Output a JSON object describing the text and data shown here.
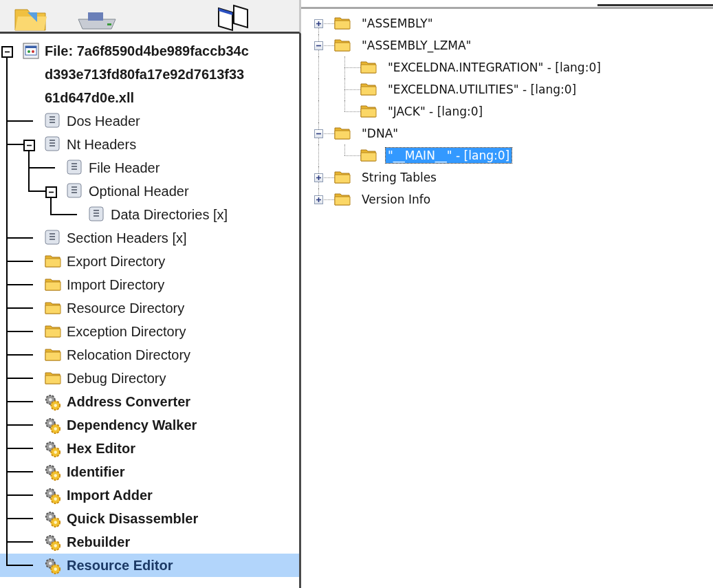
{
  "left_tree": {
    "root": {
      "title_lines": [
        "File: 7a6f8590d4be989faccb34c",
        "d393e713fd80fa17e92d7613f33",
        "61d647d0e.xll"
      ],
      "expanded": true,
      "selected": false,
      "children": [
        {
          "kind": "header",
          "label": "Dos Header",
          "selected": false
        },
        {
          "kind": "header",
          "label": "Nt Headers",
          "selected": false,
          "expanded": true,
          "children": [
            {
              "kind": "header",
              "label": "File Header",
              "selected": false
            },
            {
              "kind": "header",
              "label": "Optional Header",
              "selected": false,
              "expanded": true,
              "children": [
                {
                  "kind": "header",
                  "label": "Data Directories [x]",
                  "selected": false
                }
              ]
            }
          ]
        },
        {
          "kind": "header",
          "label": "Section Headers [x]",
          "selected": false
        },
        {
          "kind": "folder",
          "label": "Export Directory",
          "selected": false
        },
        {
          "kind": "folder",
          "label": "Import Directory",
          "selected": false
        },
        {
          "kind": "folder",
          "label": "Resource Directory",
          "selected": false
        },
        {
          "kind": "folder",
          "label": "Exception Directory",
          "selected": false
        },
        {
          "kind": "folder",
          "label": "Relocation Directory",
          "selected": false
        },
        {
          "kind": "folder",
          "label": "Debug Directory",
          "selected": false
        },
        {
          "kind": "tool",
          "label": "Address Converter",
          "selected": false
        },
        {
          "kind": "tool",
          "label": "Dependency Walker",
          "selected": false
        },
        {
          "kind": "tool",
          "label": "Hex Editor",
          "selected": false
        },
        {
          "kind": "tool",
          "label": "Identifier",
          "selected": false
        },
        {
          "kind": "tool",
          "label": "Import Adder",
          "selected": false
        },
        {
          "kind": "tool",
          "label": "Quick Disassembler",
          "selected": false
        },
        {
          "kind": "tool",
          "label": "Rebuilder",
          "selected": false
        },
        {
          "kind": "tool",
          "label": "Resource Editor",
          "selected": true
        }
      ]
    }
  },
  "right_tree": {
    "items": [
      {
        "label": "\"ASSEMBLY\"",
        "expanded": false,
        "selected": false
      },
      {
        "label": "\"ASSEMBLY_LZMA\"",
        "expanded": true,
        "selected": false,
        "children": [
          {
            "label": "\"EXCELDNA.INTEGRATION\" - [lang:0]",
            "selected": false
          },
          {
            "label": "\"EXCELDNA.UTILITIES\" - [lang:0]",
            "selected": false
          },
          {
            "label": "\"JACK\" - [lang:0]",
            "selected": false
          }
        ]
      },
      {
        "label": "\"DNA\"",
        "expanded": true,
        "selected": false,
        "children": [
          {
            "label": "\"__MAIN__\" - [lang:0]",
            "selected": true
          }
        ]
      },
      {
        "label": "String Tables",
        "expanded": false,
        "selected": false
      },
      {
        "label": "Version Info",
        "expanded": false,
        "selected": false
      }
    ]
  }
}
